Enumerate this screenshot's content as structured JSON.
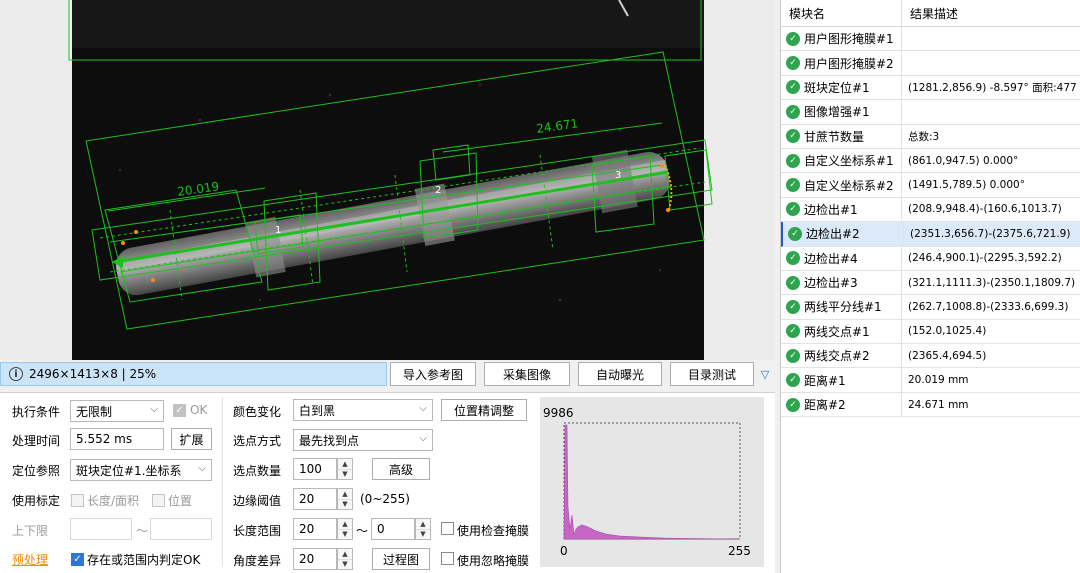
{
  "viewer": {
    "annotations": {
      "dist1": "20.019",
      "dist2": "24.671",
      "nodes": [
        "1",
        "2",
        "3"
      ]
    }
  },
  "status": {
    "image_info": "2496×1413×8 | 25%"
  },
  "toolbar": {
    "import_ref": "导入参考图",
    "capture": "采集图像",
    "auto_exposure": "自动曝光",
    "dir_test": "目录测试"
  },
  "params": {
    "exec_condition": {
      "label": "执行条件",
      "value": "无限制",
      "ok_label": "OK"
    },
    "proc_time": {
      "label": "处理时间",
      "value": "5.552 ms",
      "expand": "扩展"
    },
    "loc_ref": {
      "label": "定位参照",
      "value": "斑块定位#1.坐标系"
    },
    "use_calib": {
      "label": "使用标定",
      "opt1": "长度/面积",
      "opt2": "位置"
    },
    "limits": {
      "label": "上下限",
      "tilde": "～"
    },
    "preprocess": {
      "label": "预处理",
      "exist_label": "存在或范围内判定OK"
    },
    "color_change": {
      "label": "颜色变化",
      "value": "白到黑",
      "fine_adjust": "位置精调整"
    },
    "pick_mode": {
      "label": "选点方式",
      "value": "最先找到点"
    },
    "pick_count": {
      "label": "选点数量",
      "value": "100",
      "advanced": "高级"
    },
    "edge_thresh": {
      "label": "边缘阈值",
      "value": "20",
      "range": "(0~255)"
    },
    "length_range": {
      "label": "长度范围",
      "min": "20",
      "tilde": "～",
      "max": "0",
      "use_check_mask": "使用检查掩膜"
    },
    "angle_diff": {
      "label": "角度差异",
      "value": "20",
      "process_img": "过程图",
      "use_ignore_mask": "使用忽略掩膜"
    }
  },
  "histogram": {
    "max_label": "9986",
    "x_min": "0",
    "x_max": "255"
  },
  "results": {
    "header": {
      "col1": "模块名",
      "col2": "结果描述"
    },
    "rows": [
      {
        "name": "用户图形掩膜#1",
        "desc": ""
      },
      {
        "name": "用户图形掩膜#2",
        "desc": ""
      },
      {
        "name": "斑块定位#1",
        "desc": "(1281.2,856.9) -8.597° 面积:477"
      },
      {
        "name": "图像增强#1",
        "desc": ""
      },
      {
        "name": "甘蔗节数量",
        "desc": "总数:3"
      },
      {
        "name": "自定义坐标系#1",
        "desc": "(861.0,947.5) 0.000°"
      },
      {
        "name": "自定义坐标系#2",
        "desc": "(1491.5,789.5) 0.000°"
      },
      {
        "name": "边检出#1",
        "desc": "(208.9,948.4)-(160.6,1013.7)"
      },
      {
        "name": "边检出#2",
        "desc": "(2351.3,656.7)-(2375.6,721.9)"
      },
      {
        "name": "边检出#4",
        "desc": "(246.4,900.1)-(2295.3,592.2)"
      },
      {
        "name": "边检出#3",
        "desc": "(321.1,1111.3)-(2350.1,1809.7)"
      },
      {
        "name": "两线平分线#1",
        "desc": "(262.7,1008.8)-(2333.6,699.3)"
      },
      {
        "name": "两线交点#1",
        "desc": "(152.0,1025.4)"
      },
      {
        "name": "两线交点#2",
        "desc": "(2365.4,694.5)"
      },
      {
        "name": "距离#1",
        "desc": "20.019 mm"
      },
      {
        "name": "距离#2",
        "desc": "24.671 mm"
      }
    ],
    "selected_index": 8
  },
  "colors": {
    "accent": "#1e5bc6",
    "overlay_green": "#1fbf1f",
    "ok_green": "#2ea44f",
    "histogram_fill": "#c667c6"
  }
}
